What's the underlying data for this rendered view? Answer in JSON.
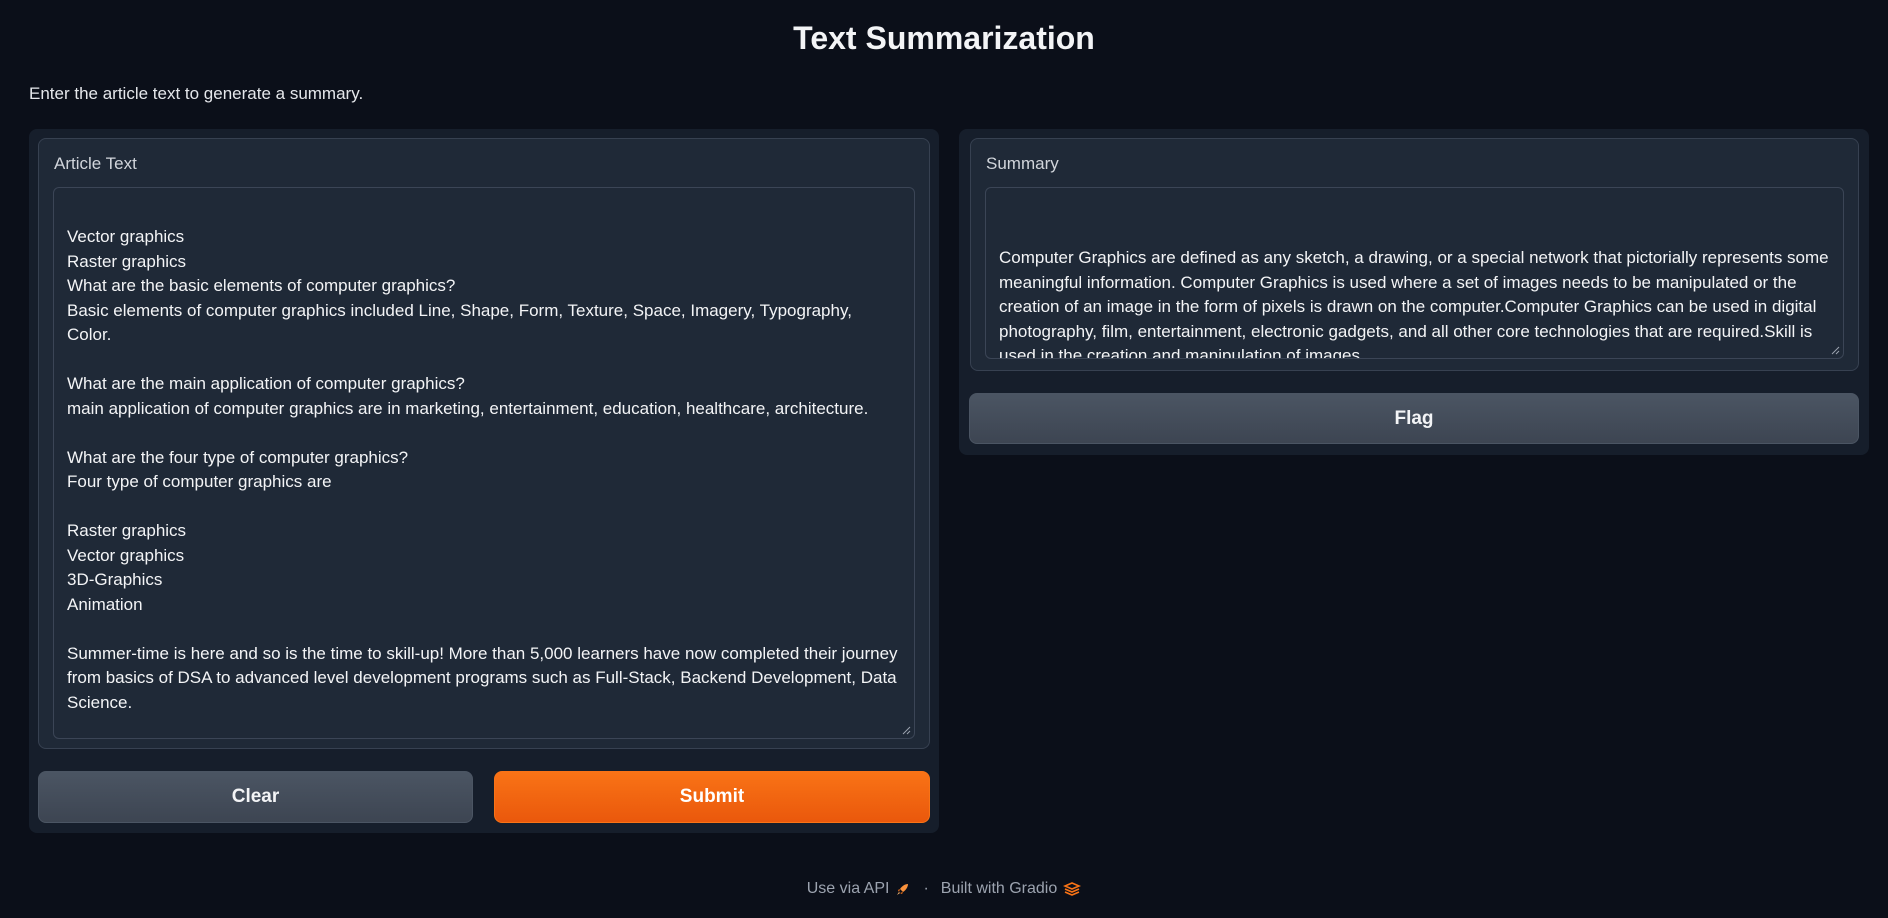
{
  "app": {
    "title": "Text Summarization",
    "description": "Enter the article text to generate a summary."
  },
  "input": {
    "label": "Article Text",
    "value": "Vector graphics\nRaster graphics\nWhat are the basic elements of computer graphics?\nBasic elements of computer graphics included Line, Shape, Form, Texture, Space, Imagery, Typography, Color.\n\nWhat are the main application of computer graphics?\nmain application of computer graphics are in marketing, entertainment, education, healthcare, architecture.\n\nWhat are the four type of computer graphics?\nFour type of computer graphics are\n\nRaster graphics\nVector graphics\n3D-Graphics\nAnimation\n\nSummer-time is here and so is the time to skill-up! More than 5,000 learners have now completed their journey from basics of DSA to advanced level development programs such as Full-Stack, Backend Development, Data Science.\n\nAnd why go anywhere else when our DSA to Development: Coding Guide will help you master all this in a few months! Apply now to our DSA to Development Program and our counsellors will connect with you for further guidance & support."
  },
  "output": {
    "label": "Summary",
    "value": "Computer Graphics are defined as any sketch, a drawing, or a special network that pictorially represents some meaningful information. Computer Graphics is used where a set of images needs to be manipulated or the creation of an image in the form of pixels is drawn on the computer.Computer Graphics can be used in digital photography, film, entertainment, electronic gadgets, and all other core technologies that are required.Skill is used in the creation and manipulation of images.\nProgramme is used to analyze trends and patterns in real-time."
  },
  "buttons": {
    "clear": "Clear",
    "submit": "Submit",
    "flag": "Flag"
  },
  "footer": {
    "api_label": "Use via API",
    "separator": "·",
    "built_label": "Built with Gradio"
  },
  "colors": {
    "background": "#0b0f19",
    "panel": "#1f2937",
    "primary": "#f97316",
    "secondary": "#4b5563"
  },
  "icons": {
    "api": "rocket-icon",
    "gradio": "gradio-logo-icon"
  }
}
